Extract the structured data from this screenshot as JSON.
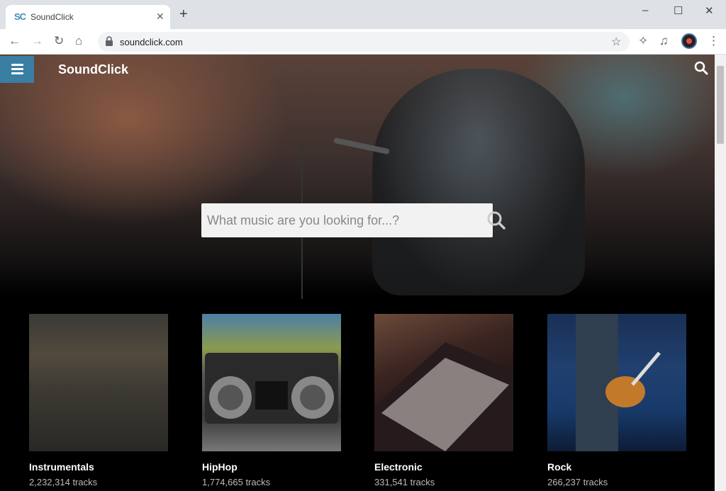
{
  "browser": {
    "tab_title": "SoundClick",
    "tab_favicon": "SC",
    "url": "soundclick.com",
    "new_tab_icon": "+",
    "window_controls": [
      "minimize-icon",
      "maximize-icon",
      "close-icon"
    ]
  },
  "site": {
    "logo": "SoundClick",
    "search_placeholder": "What music are you looking for...?"
  },
  "genres": [
    {
      "name": "Instrumentals",
      "count": "2,232,314 tracks"
    },
    {
      "name": "HipHop",
      "count": "1,774,665 tracks"
    },
    {
      "name": "Electronic",
      "count": "331,541 tracks"
    },
    {
      "name": "Rock",
      "count": "266,237 tracks"
    }
  ],
  "colors": {
    "menu_button": "#3a7ea3",
    "page_background": "#000000"
  }
}
